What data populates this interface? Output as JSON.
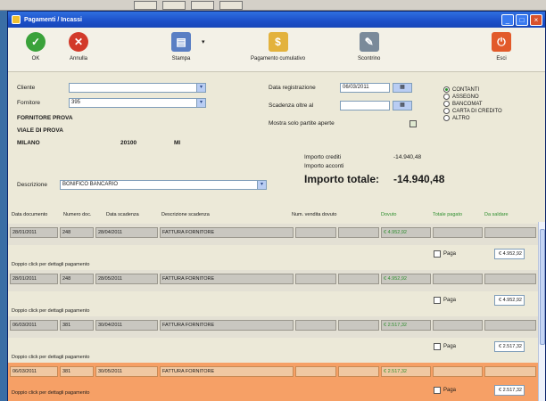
{
  "window": {
    "title": "Pagamenti / Incassi"
  },
  "toolbar": {
    "ok": "OK",
    "annulla": "Annulla",
    "stampa": "Stampa",
    "pagamento_cumulativo": "Pagamento cumulativo",
    "scontrino": "Scontrino",
    "esci": "Esci"
  },
  "form": {
    "cliente_label": "Cliente",
    "cliente_value": "",
    "fornitore_label": "Fornitore",
    "fornitore_value": "395",
    "address_line1": "FORNITORE PROVA",
    "address_line2": "VIALE DI PROVA",
    "city": "MILANO",
    "cap": "20100",
    "province": "MI",
    "data_registrazione_label": "Data registrazione",
    "data_registrazione_value": "06/03/2011",
    "scadenza_label": "Scadenza oltre al",
    "scadenza_value": "",
    "mostra_label": "Mostra solo partite aperte",
    "descrizione_label": "Descrizione",
    "descrizione_value": "BONIFICO BANCARIO",
    "payment_methods": [
      "CONTANTI",
      "ASSEGNO",
      "BANCOMAT",
      "CARTA DI CREDITO",
      "ALTRO"
    ],
    "importo_crediti_label": "Importo crediti",
    "importo_crediti_value": "-14.940,48",
    "importo_acconti_label": "Importo acconti",
    "importo_totale_label": "Importo totale:",
    "importo_totale_value": "-14.940,48"
  },
  "grid": {
    "headers": [
      "Data documento",
      "Numero doc.",
      "Data scadenza",
      "Descrizione scadenza",
      "Num. vendita dovuto",
      "Dovuto",
      "Totale pagato",
      "Da saldare"
    ],
    "rows": [
      {
        "data_doc": "28/01/2011",
        "num_doc": "248",
        "data_scad": "28/04/2011",
        "descr": "FATTURA FORNITORE",
        "dovuto": "€ 4.952,92",
        "paga": "Paga",
        "amount": "€ 4.952,92",
        "hint": "Doppio click per dettagli pagamento"
      },
      {
        "data_doc": "28/01/2011",
        "num_doc": "248",
        "data_scad": "28/05/2011",
        "descr": "FATTURA FORNITORE",
        "dovuto": "€ 4.952,92",
        "paga": "Paga",
        "amount": "€ 4.952,92",
        "hint": "Doppio click per dettagli pagamento"
      },
      {
        "data_doc": "06/03/2011",
        "num_doc": "381",
        "data_scad": "30/04/2011",
        "descr": "FATTURA FORNITORE",
        "dovuto": "€ 2.517,32",
        "paga": "Paga",
        "amount": "€ 2.517,32",
        "hint": "Doppio click per dettagli pagamento"
      },
      {
        "data_doc": "06/03/2011",
        "num_doc": "381",
        "data_scad": "30/05/2011",
        "descr": "FATTURA FORNITORE",
        "dovuto": "€ 2.517,32",
        "paga": "Paga",
        "amount": "€ 2.517,32",
        "hint": "Doppio click per dettagli pagamento"
      }
    ]
  }
}
